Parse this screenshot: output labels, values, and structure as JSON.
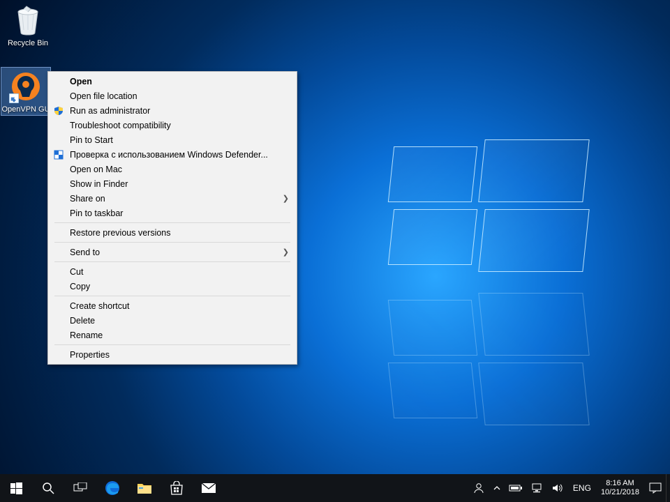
{
  "desktop_icons": {
    "recycle_bin": "Recycle Bin",
    "openvpn": "OpenVPN GU"
  },
  "context_menu": {
    "open": "Open",
    "open_file_location": "Open file location",
    "run_as_admin": "Run as administrator",
    "troubleshoot": "Troubleshoot compatibility",
    "pin_start": "Pin to Start",
    "defender": "Проверка с использованием Windows Defender...",
    "open_on_mac": "Open on Mac",
    "show_in_finder": "Show in Finder",
    "share_on": "Share on",
    "pin_taskbar": "Pin to taskbar",
    "restore": "Restore previous versions",
    "send_to": "Send to",
    "cut": "Cut",
    "copy": "Copy",
    "create_shortcut": "Create shortcut",
    "delete": "Delete",
    "rename": "Rename",
    "properties": "Properties"
  },
  "taskbar": {
    "lang": "ENG",
    "time": "8:16 AM",
    "date": "10/21/2018"
  }
}
